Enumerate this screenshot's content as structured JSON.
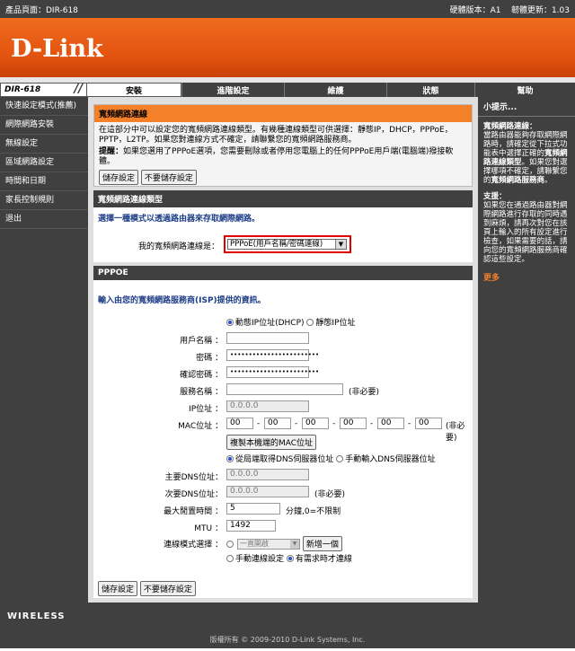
{
  "topbar": {
    "product": "產品頁面：DIR-618",
    "hw_version": "硬體版本：A1",
    "fw_version": "韌體更新：1.03"
  },
  "brand": {
    "logo": "D-Link",
    "model": "DIR-618",
    "footer_brand": "WIRELESS",
    "copyright": "版權所有 © 2009-2010 D-Link Systems, Inc."
  },
  "nav": {
    "tabs": [
      "安裝",
      "進階設定",
      "維護",
      "狀態",
      "幫助"
    ],
    "active": 0
  },
  "sidebar": {
    "items": [
      "快速設定模式(推薦)",
      "網際網路安裝",
      "無線設定",
      "區域網路設定",
      "時間和日期",
      "家長控制規則",
      "退出"
    ]
  },
  "intro": {
    "title": "寬頻網路連線",
    "desc": "在這部分中可以設定您的寬頻網路連線類型。有幾種連線類型可供選擇：靜態IP，DHCP，PPPoE，PPTP，L2TP。如果您對連線方式不確定，請聯繫您的寬頻網路服務商。",
    "note_label": "提醒：",
    "note": "如果您選用了PPPoE選項，您需要刪除或者停用您電腦上的任何PPPoE用戶端(電腦端)撥接軟體。",
    "save": "儲存設定",
    "cancel": "不要儲存設定"
  },
  "conntype": {
    "title": "寬頻網路連線類型",
    "prompt": "選擇一種模式以透過路由器來存取網際網路。",
    "label": "我的寬頻網路連線是：",
    "selected": "PPPoE(用戶名稱/密碼連線)"
  },
  "pppoe": {
    "title": "PPPOE",
    "prompt": "輸入由您的寬頻網路服務商(ISP)提供的資訊。",
    "ip_dynamic": "動態IP位址(DHCP)",
    "ip_static": "靜態IP位址",
    "username_label": "用戶名稱 ：",
    "password_label": "密碼 ：",
    "password_value": "••••••••••••••••••••••••",
    "confirm_label": "確認密碼 ：",
    "confirm_value": "••••••••••••••••••••••••",
    "service_label": "服務名稱 ：",
    "optional": "(非必要)",
    "ip_label": "IP位址 ：",
    "ip_value": "0.0.0.0",
    "mac_label": "MAC位址 ：",
    "mac": [
      "00",
      "00",
      "00",
      "00",
      "00",
      "00"
    ],
    "mac_sep": "-",
    "clone_mac": "複製本機端的MAC位址",
    "dns_auto": "從局端取得DNS伺服器位址",
    "dns_manual": "手動輸入DNS伺服器位址",
    "dns1_label": "主要DNS位址：",
    "dns1_value": "0.0.0.0",
    "dns2_label": "次要DNS位址：",
    "dns2_value": "0.0.0.0",
    "idle_label": "最大閒置時間 ：",
    "idle_value": "5",
    "idle_unit": "分鐘,0=不限制",
    "mtu_label": "MTU ：",
    "mtu_value": "1492",
    "schedule_label": "連線模式選擇 ：",
    "schedule_value": "一直開啟",
    "add_new": "新增一個",
    "manual_connect": "手動連線設定",
    "on_demand": "有需求時才連線",
    "save": "儲存設定",
    "cancel": "不要儲存設定"
  },
  "hints": {
    "title": "小提示...",
    "h1_title": "寬頻網路連線：",
    "h1_a": "當路由器能夠存取網際網路時，請確定從下拉式功能表中選擇正確的",
    "h1_bold": "寬頻網路連線類型",
    "h1_b": "。如果您對選擇哪項不確定，請聯繫您的",
    "h1_bold2": "寬頻網路服務商",
    "h1_c": "。",
    "h2_title": "支援：",
    "h2_text": "如果您在通過路由器對網際網路進行存取的同時遇到麻煩，請再次對您在該頁上輸入的所有設定進行檢查，如果需要的話，請向您的寬頻網路服務商確認這些設定。",
    "more": "更多"
  }
}
